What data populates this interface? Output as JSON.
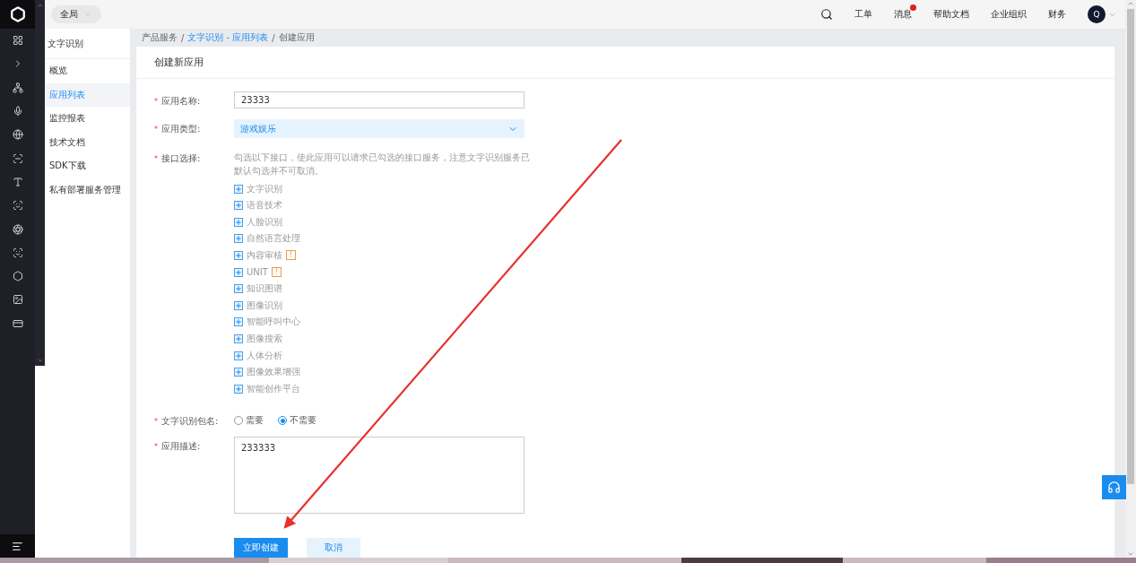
{
  "top_bar": {
    "scope": "全局",
    "nav": [
      {
        "label": "工单",
        "badge": false
      },
      {
        "label": "消息",
        "badge": true
      },
      {
        "label": "帮助文档",
        "badge": false
      },
      {
        "label": "企业组织",
        "badge": false
      },
      {
        "label": "财务",
        "badge": false
      }
    ],
    "avatar": "Q"
  },
  "sidebar": {
    "title": "文字识别",
    "items": [
      {
        "label": "概览",
        "selected": false
      },
      {
        "label": "应用列表",
        "selected": true
      },
      {
        "label": "监控报表",
        "selected": false
      },
      {
        "label": "技术文档",
        "selected": false
      },
      {
        "label": "SDK下载",
        "selected": false
      },
      {
        "label": "私有部署服务管理",
        "selected": false
      }
    ]
  },
  "breadcrumb": {
    "separator": "/",
    "items": [
      {
        "label": "产品服务",
        "link": false
      },
      {
        "label": "文字识别 - 应用列表",
        "link": true
      },
      {
        "label": "创建应用",
        "link": false
      }
    ]
  },
  "required_mark": "*",
  "form": {
    "title": "创建新应用",
    "name": {
      "label": "应用名称:",
      "value": "23333"
    },
    "type": {
      "label": "应用类型:",
      "value": "游戏娱乐"
    },
    "apis": {
      "label": "接口选择:",
      "hint": "勾选以下接口，使此应用可以请求已勾选的接口服务，注意文字识别服务已默认勾选并不可取消。",
      "items": [
        {
          "label": "文字识别"
        },
        {
          "label": "语音技术"
        },
        {
          "label": "人脸识别"
        },
        {
          "label": "自然语言处理"
        },
        {
          "label": "内容审核",
          "warning": "!"
        },
        {
          "label": "UNIT",
          "warning": "!"
        },
        {
          "label": "知识图谱"
        },
        {
          "label": "图像识别"
        },
        {
          "label": "智能呼叫中心"
        },
        {
          "label": "图像搜索"
        },
        {
          "label": "人体分析"
        },
        {
          "label": "图像效果增强"
        },
        {
          "label": "智能创作平台"
        }
      ]
    },
    "package": {
      "label": "文字识别包名:",
      "options": [
        {
          "label": "需要",
          "selected": false
        },
        {
          "label": "不需要",
          "selected": true
        }
      ]
    },
    "description": {
      "label": "应用描述:",
      "value": "233333"
    },
    "buttons": [
      {
        "label": "立即创建",
        "kind": "primary"
      },
      {
        "label": "取消",
        "kind": "secondary"
      }
    ]
  }
}
